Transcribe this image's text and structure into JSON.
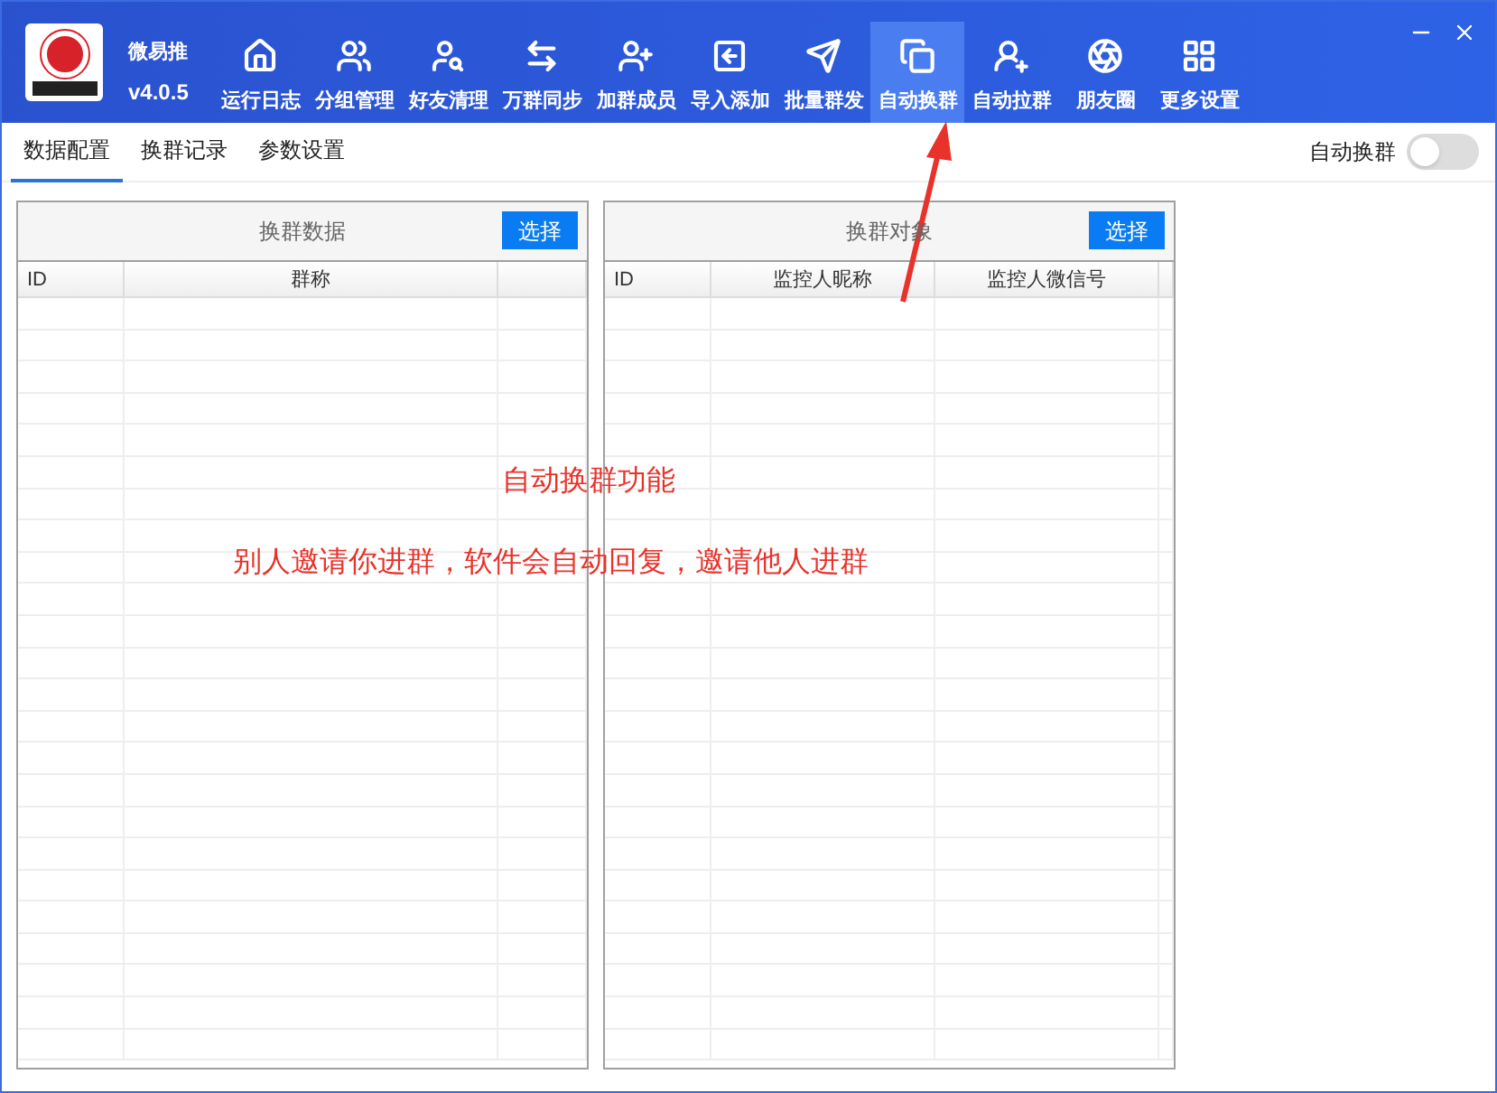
{
  "app": {
    "name": "微易推",
    "version": "v4.0.5"
  },
  "toolbar": [
    {
      "label": "运行日志",
      "selected": false
    },
    {
      "label": "分组管理",
      "selected": false
    },
    {
      "label": "好友清理",
      "selected": false
    },
    {
      "label": "万群同步",
      "selected": false
    },
    {
      "label": "加群成员",
      "selected": false
    },
    {
      "label": "导入添加",
      "selected": false
    },
    {
      "label": "批量群发",
      "selected": false
    },
    {
      "label": "自动换群",
      "selected": true
    },
    {
      "label": "自动拉群",
      "selected": false
    },
    {
      "label": "朋友圈",
      "selected": false
    },
    {
      "label": "更多设置",
      "selected": false
    }
  ],
  "tabs": [
    {
      "label": "数据配置",
      "selected": true
    },
    {
      "label": "换群记录",
      "selected": false
    },
    {
      "label": "参数设置",
      "selected": false
    }
  ],
  "auto_switch": {
    "label": "自动换群",
    "on": false
  },
  "panels": [
    {
      "title": "换群数据",
      "button": "选择",
      "columns": [
        "ID",
        "群称",
        ""
      ]
    },
    {
      "title": "换群对象",
      "button": "选择",
      "columns": [
        "ID",
        "监控人昵称",
        "监控人微信号",
        ""
      ]
    }
  ],
  "annotations": {
    "title": "自动换群功能",
    "text": "别人邀请你进群，软件会自动回复，邀请他人进群"
  }
}
